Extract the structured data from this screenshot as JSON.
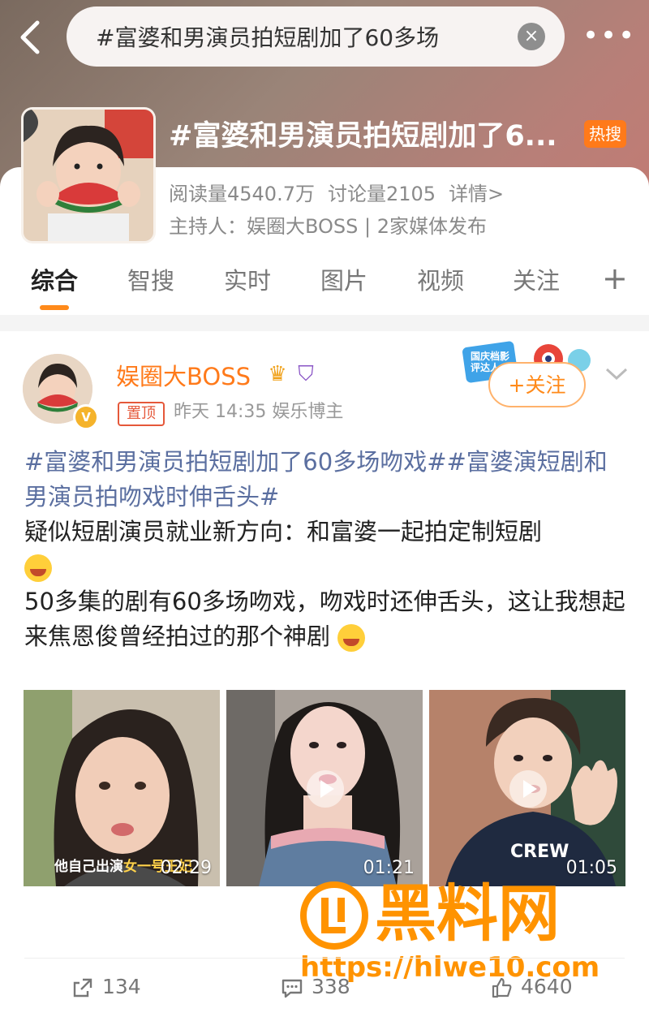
{
  "search": {
    "query": "#富婆和男演员拍短剧加了60多场"
  },
  "topic": {
    "title": "#富婆和男演员拍短剧加了6...",
    "hot_badge": "热搜",
    "reads": "阅读量4540.7万",
    "discussions": "讨论量2105",
    "details": "详情>",
    "host": "主持人：娱圈大BOSS | 2家媒体发布"
  },
  "tabs": [
    "综合",
    "智搜",
    "实时",
    "图片",
    "视频",
    "关注"
  ],
  "post": {
    "author": "娱圈大BOSS",
    "pinned": "置顶",
    "meta": "昨天 14:35  娱乐博主",
    "follow_label": "+关注",
    "promo_label": "国庆档影评达人",
    "tags": "#富婆和男演员拍短剧加了60多场吻戏##富婆演短剧和男演员拍吻戏时伸舌头#",
    "line1": "疑似短剧演员就业新方向：和富婆一起拍定制短剧",
    "line2": "50多集的剧有60多场吻戏，吻戏时还伸舌头，这让我想起来焦恩俊曾经拍过的那个神剧",
    "videos": [
      {
        "duration": "02:29",
        "subtitle_white": "他自己出演",
        "subtitle_yellow": "女一号王妃"
      },
      {
        "duration": "01:21"
      },
      {
        "duration": "01:05",
        "shirt": "CREW"
      }
    ],
    "actions": {
      "share": "134",
      "comment": "338",
      "like": "4640"
    }
  },
  "watermark": {
    "text": "黑料网",
    "url": "https://hlwe10.com"
  },
  "colors": {
    "accent": "#ff7a1a",
    "tag_blue": "#5b6fa0",
    "watermark": "#ff9300"
  }
}
